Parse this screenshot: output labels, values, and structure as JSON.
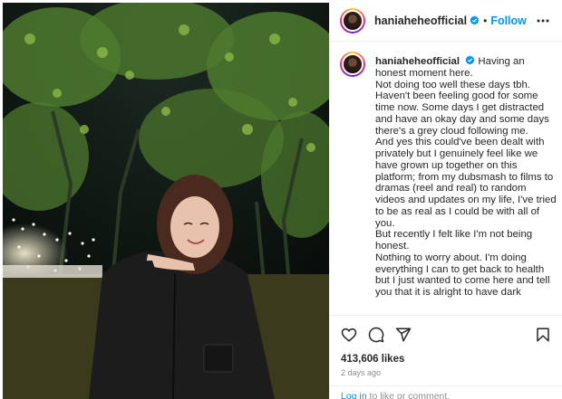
{
  "post": {
    "username": "haniaheheofficial",
    "follow_label": "Follow",
    "separator": "•",
    "caption_first": "Having an honest moment here.",
    "caption_lines": [
      "Not doing too well these days tbh. Haven't been feeling good for some time now. Some days I get distracted and have an okay day and some days there's a grey cloud following me.",
      "And yes this could've been dealt with privately but I genuinely feel like we have grown up together on this platform; from my dubsmash to films to dramas (reel and real) to random videos and updates on my life, I've tried to be as real as I could be with all of you.",
      "But recently I felt like I'm not being honest.",
      "Nothing to worry about. I'm doing everything I can to get back to health but I just wanted to come here and tell you that it is alright to have dark"
    ],
    "likes_count": "413,606",
    "likes_word": "likes",
    "time_ago": "2 days ago",
    "footer": {
      "login_link": "Log in",
      "login_rest": " to like or comment."
    }
  },
  "icons": [
    "verified-icon",
    "more-options-icon",
    "heart-icon",
    "comment-icon",
    "share-icon",
    "save-icon"
  ],
  "colors": {
    "accent": "#0095f6",
    "text": "#262626",
    "muted": "#8e8e8e",
    "border": "#efefef"
  }
}
